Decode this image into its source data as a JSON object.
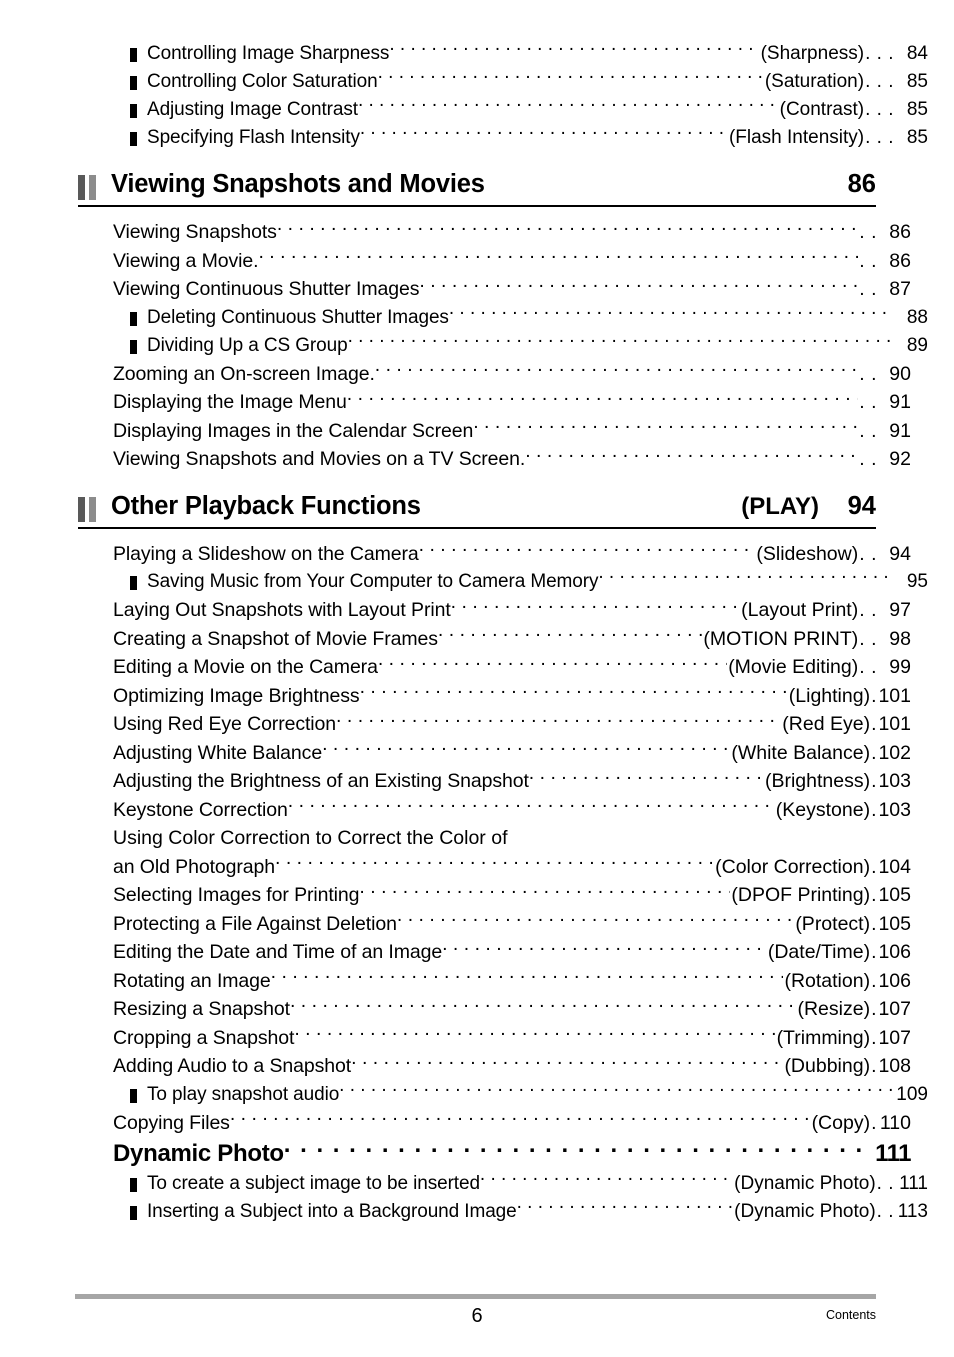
{
  "document": {
    "footer": {
      "page_number": "6",
      "label": "Contents"
    }
  },
  "toc": {
    "top_subitems": [
      {
        "title": "Controlling Image Sharpness",
        "tag": "(Sharpness)",
        "tail": ". . .",
        "page": "84"
      },
      {
        "title": "Controlling Color Saturation",
        "tag": "(Saturation)",
        "tail": ". . .",
        "page": "85"
      },
      {
        "title": "Adjusting Image Contrast",
        "tag": "(Contrast)",
        "tail": ". . .",
        "page": "85"
      },
      {
        "title": "Specifying Flash Intensity",
        "tag": "(Flash Intensity)",
        "tail": ". . .",
        "page": "85"
      }
    ],
    "chapters": [
      {
        "title": "Viewing Snapshots and Movies",
        "tag": "",
        "page": "86",
        "entries": [
          {
            "level": 1,
            "title": "Viewing Snapshots",
            "tag": "",
            "tail": ". .",
            "page": "86"
          },
          {
            "level": 1,
            "title": "Viewing a Movie.",
            "tag": "",
            "tail": ". .",
            "page": "86"
          },
          {
            "level": 1,
            "title": "Viewing Continuous Shutter Images",
            "tag": "",
            "tail": ". .",
            "page": "87"
          },
          {
            "level": 2,
            "title": "Deleting Continuous Shutter Images",
            "tag": "",
            "tail": "",
            "page": "88"
          },
          {
            "level": 2,
            "title": "Dividing Up a CS Group",
            "tag": "",
            "tail": "",
            "page": "89"
          },
          {
            "level": 1,
            "title": "Zooming an On-screen Image.",
            "tag": "",
            "tail": ". .",
            "page": "90"
          },
          {
            "level": 1,
            "title": "Displaying the Image Menu",
            "tag": "",
            "tail": ". .",
            "page": "91"
          },
          {
            "level": 1,
            "title": "Displaying Images in the Calendar Screen",
            "tag": "",
            "tail": ". .",
            "page": "91"
          },
          {
            "level": 1,
            "title": "Viewing Snapshots and Movies on a TV Screen.",
            "tag": "",
            "tail": ". .",
            "page": "92"
          }
        ]
      },
      {
        "title": "Other Playback Functions",
        "tag": "(PLAY)",
        "page": "94",
        "entries": [
          {
            "level": 1,
            "title": "Playing a Slideshow on the Camera",
            "tag": "(Slideshow)",
            "tail": ". .",
            "page": "94"
          },
          {
            "level": 2,
            "title": "Saving Music from Your Computer to Camera Memory",
            "tag": "",
            "tail": "",
            "page": "95"
          },
          {
            "level": 1,
            "title": "Laying Out Snapshots with Layout Print",
            "tag": "(Layout Print)",
            "tail": ". .",
            "page": "97"
          },
          {
            "level": 1,
            "title": "Creating a Snapshot of Movie Frames",
            "tag": "(MOTION PRINT)",
            "tail": ". .",
            "page": "98"
          },
          {
            "level": 1,
            "title": "Editing a Movie on the Camera",
            "tag": "(Movie Editing)",
            "tail": ". .",
            "page": "99"
          },
          {
            "level": 1,
            "title": "Optimizing Image Brightness",
            "tag": "(Lighting)",
            "tail": ".",
            "page": "101"
          },
          {
            "level": 1,
            "title": "Using Red Eye Correction",
            "tag": "(Red Eye)",
            "tail": ".",
            "page": "101"
          },
          {
            "level": 1,
            "title": "Adjusting White Balance",
            "tag": "(White Balance)",
            "tail": ".",
            "page": "102"
          },
          {
            "level": 1,
            "title": "Adjusting the Brightness of an Existing Snapshot",
            "tag": "(Brightness)",
            "tail": ".",
            "page": "103"
          },
          {
            "level": 1,
            "title": "Keystone Correction",
            "tag": "(Keystone)",
            "tail": ".",
            "page": "103"
          },
          {
            "level": 0,
            "title": "Using Color Correction to Correct the Color of",
            "tag": "",
            "tail": "",
            "page": ""
          },
          {
            "level": 1,
            "title": "an Old Photograph",
            "tag": "(Color Correction)",
            "tail": ".",
            "page": "104"
          },
          {
            "level": 1,
            "title": "Selecting Images for Printing",
            "tag": "(DPOF Printing)",
            "tail": ".",
            "page": "105"
          },
          {
            "level": 1,
            "title": "Protecting a File Against Deletion",
            "tag": "(Protect)",
            "tail": ".",
            "page": "105"
          },
          {
            "level": 1,
            "title": "Editing the Date and Time of an Image",
            "tag": "(Date/Time)",
            "tail": ".",
            "page": "106"
          },
          {
            "level": 1,
            "title": "Rotating an Image",
            "tag": "(Rotation)",
            "tail": ".",
            "page": "106"
          },
          {
            "level": 1,
            "title": "Resizing a Snapshot",
            "tag": "(Resize)",
            "tail": ".",
            "page": "107"
          },
          {
            "level": 1,
            "title": "Cropping a Snapshot",
            "tag": "(Trimming)",
            "tail": ".",
            "page": "107"
          },
          {
            "level": 1,
            "title": "Adding Audio to a Snapshot",
            "tag": "(Dubbing)",
            "tail": ".",
            "page": "108"
          },
          {
            "level": 2,
            "title": "To play snapshot audio",
            "tag": "",
            "tail": "",
            "page": "109"
          },
          {
            "level": 1,
            "title": "Copying Files",
            "tag": "(Copy)",
            "tail": ".",
            "page": "110"
          },
          {
            "level": 3,
            "title": "Dynamic Photo",
            "tag": "",
            "tail": "",
            "page": "111"
          },
          {
            "level": 2,
            "title": "To create a subject image to be inserted",
            "tag": "(Dynamic Photo)",
            "tail": ". .",
            "page": "111"
          },
          {
            "level": 2,
            "title": "Inserting a Subject into a Background Image",
            "tag": "(Dynamic Photo)",
            "tail": ". .",
            "page": "113"
          }
        ]
      }
    ]
  }
}
